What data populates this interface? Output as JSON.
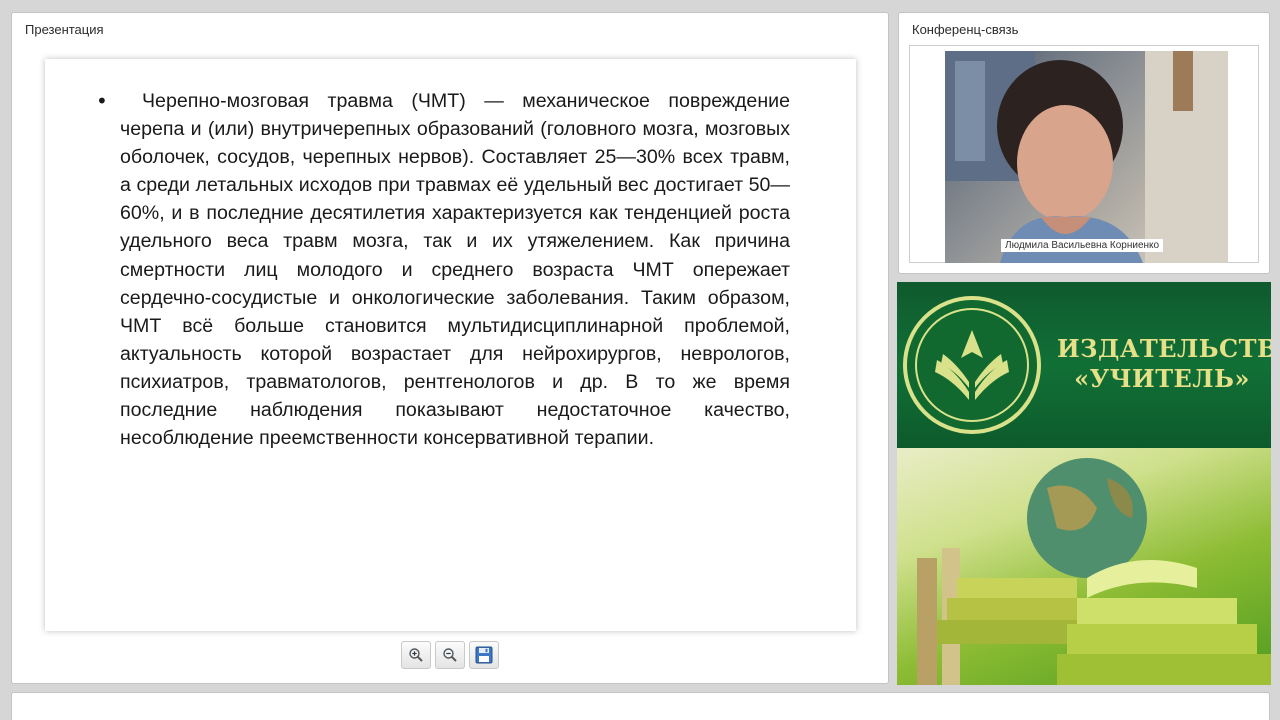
{
  "presentation": {
    "title": "Презентация",
    "slide": {
      "bullet": "•",
      "text": "Черепно-мозговая травма (ЧМТ) — механическое повреждение черепа и (или) внутричерепных образований (головного мозга, мозговых оболочек, сосудов, черепных нервов). Составляет 25—30% всех травм, а среди летальных исходов при травмах её удельный вес достигает 50—60%, и в последние десятилетия характеризуется как тенденцией роста удельного веса травм мозга, так и их утяжелением. Как причина смертности лиц молодого и среднего возраста ЧМТ опережает сердечно-сосудистые и онкологические заболевания. Таким образом, ЧМТ всё больше становится мультидисциплинарной проблемой, актуальность которой возрастает для нейрохирургов, неврологов, психиатров, травматологов, рентгенологов и др. В то же время последние наблюдения показывают недостаточное качество, несоблюдение преемственности консервативной терапии."
    },
    "toolbar": {
      "zoom_in_icon": "zoom-in-icon",
      "zoom_out_icon": "zoom-out-icon",
      "save_icon": "floppy-disk-icon"
    }
  },
  "conference": {
    "title": "Конференц-связь",
    "participant_name": "Людмила Васильевна Корниенко"
  },
  "banner": {
    "publisher_line1": "ИЗДАТЕЛЬСТВО",
    "publisher_line2": "«УЧИТЕЛЬ»",
    "colors": {
      "green": "#117036",
      "gold": "#e6e089"
    }
  }
}
